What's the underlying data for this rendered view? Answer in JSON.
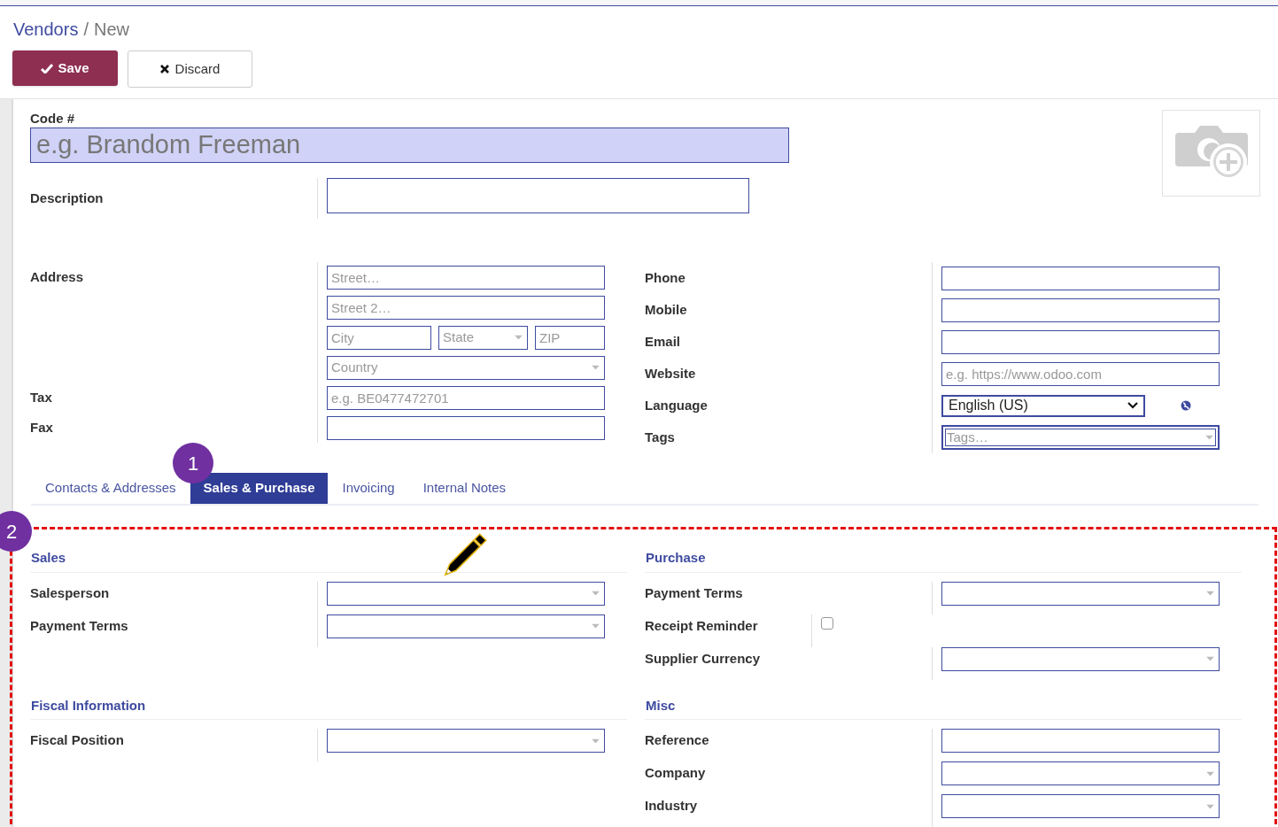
{
  "breadcrumb": {
    "parent": "Vendors",
    "separator": "/",
    "current": "New"
  },
  "actions": [
    {
      "label": "Save",
      "kind": "primary"
    },
    {
      "label": "Discard",
      "kind": "secondary"
    }
  ],
  "name_field": {
    "label": "Code #",
    "placeholder": "e.g. Brandom Freeman"
  },
  "description": {
    "label": "Description"
  },
  "contact_left": [
    {
      "label": "Address",
      "inputs": [
        {
          "kind": "text",
          "placeholder": "Street…"
        }
      ]
    },
    {
      "inputs": [
        {
          "kind": "text",
          "placeholder": "Street 2…"
        }
      ]
    },
    {
      "inputs": [
        {
          "kind": "text",
          "placeholder": "City"
        },
        {
          "kind": "select",
          "placeholder": "State"
        },
        {
          "kind": "text",
          "placeholder": "ZIP"
        }
      ]
    },
    {
      "inputs": [
        {
          "kind": "select",
          "placeholder": "Country"
        }
      ]
    },
    {
      "label": "Tax",
      "inputs": [
        {
          "kind": "text",
          "placeholder": "e.g. BE0477472701"
        }
      ]
    },
    {
      "label": "Fax",
      "inputs": [
        {
          "kind": "text"
        }
      ]
    }
  ],
  "contact_right": [
    {
      "label": "Phone",
      "inputs": [
        {
          "kind": "text"
        }
      ]
    },
    {
      "label": "Mobile",
      "inputs": [
        {
          "kind": "text"
        }
      ]
    },
    {
      "label": "Email",
      "inputs": [
        {
          "kind": "text"
        }
      ]
    },
    {
      "label": "Website",
      "inputs": [
        {
          "kind": "text",
          "placeholder": "e.g. https://www.odoo.com"
        }
      ]
    },
    {
      "label": "Language",
      "inputs": [
        {
          "kind": "dropdown",
          "value": "English (US)"
        }
      ]
    },
    {
      "label": "Tags",
      "inputs": [
        {
          "kind": "tags",
          "placeholder": "Tags…"
        }
      ]
    }
  ],
  "tabs": [
    {
      "label": "Contacts & Addresses",
      "selected": false
    },
    {
      "label": "Sales & Purchase",
      "selected": true
    },
    {
      "label": "Invoicing",
      "selected": false
    },
    {
      "label": "Internal Notes",
      "selected": false
    }
  ],
  "markers": [
    {
      "label": "1"
    },
    {
      "label": "2"
    }
  ],
  "sections": [
    {
      "title": "Sales",
      "fields": [
        {
          "label": "Salesperson",
          "kind": "select"
        },
        {
          "label": "Payment Terms",
          "kind": "select"
        }
      ]
    },
    {
      "title": "Purchase",
      "fields": [
        {
          "label": "Payment Terms",
          "kind": "select"
        },
        {
          "label": "Receipt Reminder",
          "kind": "checkbox",
          "checked": false
        },
        {
          "label": "Supplier Currency",
          "kind": "select"
        }
      ]
    },
    {
      "title": "Fiscal Information",
      "fields": [
        {
          "label": "Fiscal Position",
          "kind": "select"
        }
      ]
    },
    {
      "title": "Misc",
      "fields": [
        {
          "label": "Reference",
          "kind": "text"
        },
        {
          "label": "Company",
          "kind": "select"
        },
        {
          "label": "Industry",
          "kind": "select"
        }
      ]
    }
  ]
}
